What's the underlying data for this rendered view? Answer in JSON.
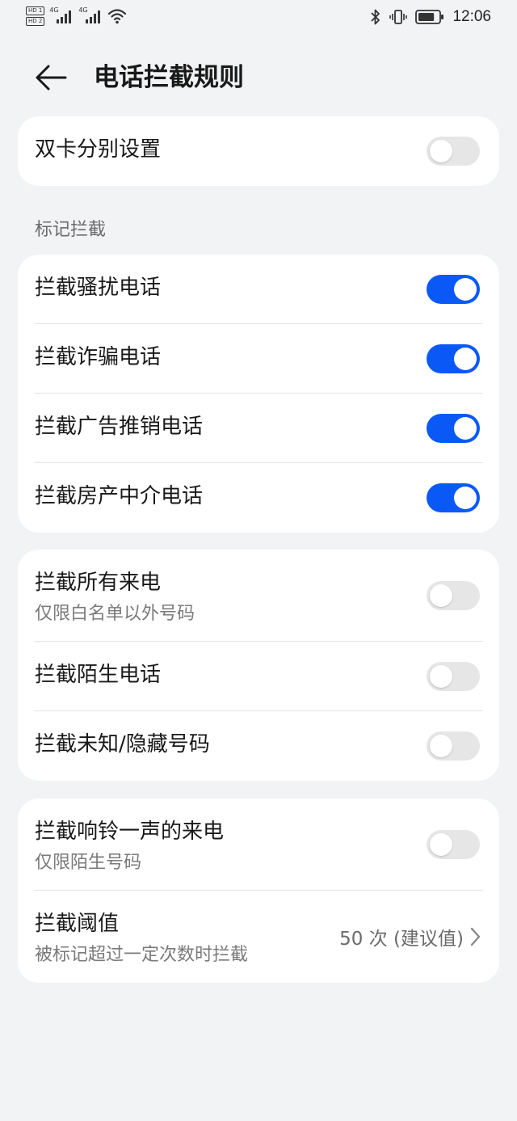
{
  "status_bar": {
    "hd1": "HD 1",
    "hd2": "HD 2",
    "net1": "4G",
    "net2": "4G",
    "battery_level": 0.8,
    "time": "12:06"
  },
  "header": {
    "title": "电话拦截规则"
  },
  "dual_sim": {
    "label": "双卡分别设置",
    "on": false
  },
  "marked_section": {
    "label": "标记拦截",
    "items": [
      {
        "label": "拦截骚扰电话",
        "on": true
      },
      {
        "label": "拦截诈骗电话",
        "on": true
      },
      {
        "label": "拦截广告推销电话",
        "on": true
      },
      {
        "label": "拦截房产中介电话",
        "on": true
      }
    ]
  },
  "calls_group": {
    "items": [
      {
        "label": "拦截所有来电",
        "sub": "仅限白名单以外号码",
        "on": false
      },
      {
        "label": "拦截陌生电话",
        "on": false
      },
      {
        "label": "拦截未知/隐藏号码",
        "on": false
      }
    ]
  },
  "ring_group": {
    "ring_once": {
      "label": "拦截响铃一声的来电",
      "sub": "仅限陌生号码",
      "on": false
    },
    "threshold": {
      "label": "拦截阈值",
      "sub": "被标记超过一定次数时拦截",
      "value": "50 次 (建议值)"
    }
  },
  "colors": {
    "accent": "#0a59f7",
    "toggle_off": "#e6e6e6",
    "background": "#f1f3f5"
  }
}
